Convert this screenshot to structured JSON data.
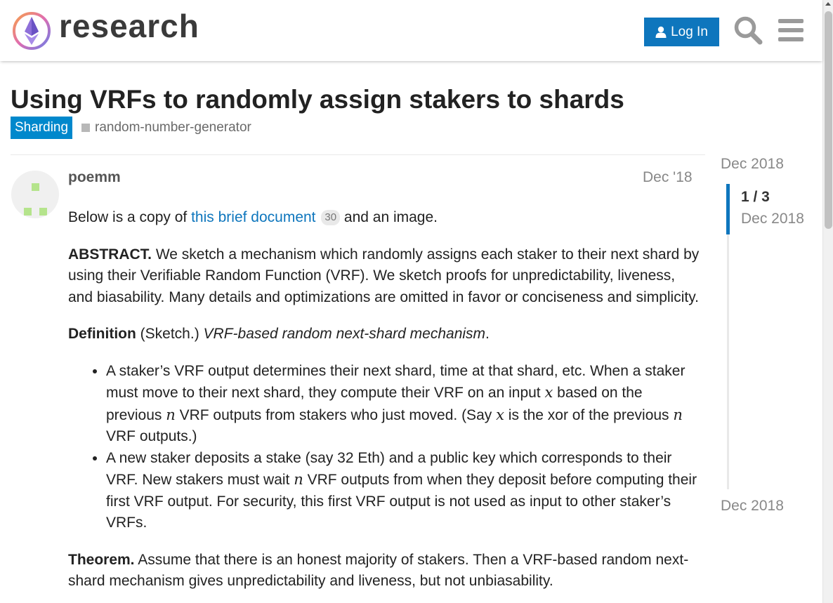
{
  "site": {
    "name": "research"
  },
  "header": {
    "login_label": "Log In"
  },
  "topic": {
    "title": "Using VRFs to randomly assign stakers to shards",
    "category": "Sharding",
    "tag": "random-number-generator"
  },
  "post": {
    "username": "poemm",
    "date": "Dec '18",
    "intro_pre": "Below is a copy of ",
    "intro_link": "this brief document",
    "intro_clicks": "30",
    "intro_post": " and an image.",
    "abstract_label": "ABSTRACT.",
    "abstract_text": " We sketch a mechanism which randomly assigns each staker to their next shard by using their Verifiable Random Function (VRF). We sketch proofs for unpredictability, liveness, and biasability. Many details and optimizations are omitted in favor or conciseness and simplicity.",
    "definition_label": "Definition",
    "definition_paren": " (Sketch.) ",
    "definition_name": "VRF-based random next-shard mechanism",
    "definition_end": ".",
    "bullet1_a": "A staker’s VRF output determines their next shard, time at that shard, etc. When a staker must move to their next shard, they compute their VRF on an input ",
    "bullet1_b": " based on the previous ",
    "bullet1_c": " VRF outputs from stakers who just moved. (Say ",
    "bullet1_d": " is the xor of the previous ",
    "bullet1_e": " VRF outputs.)",
    "bullet2_a": "A new staker deposits a stake (say 32 Eth) and a public key which corresponds to their VRF. New stakers must wait ",
    "bullet2_b": " VRF outputs from when they deposit before computing their first VRF output. For security, this first VRF output is not used as input to other staker’s VRFs.",
    "math_x": "x",
    "math_n": "n",
    "theorem_label": "Theorem.",
    "theorem_text": " Assume that there is an honest majority of stakers. Then a VRF-based random next-shard mechanism gives unpredictability and liveness, but not unbiasability."
  },
  "timeline": {
    "top_date": "Dec 2018",
    "position": "1 / 3",
    "current_date": "Dec 2018",
    "bottom_date": "Dec 2018"
  },
  "colors": {
    "accent": "#0e76bd",
    "category": "#0088cc",
    "avatar_fg": "#b5e48c"
  },
  "icons": [
    "logo-icon",
    "user-icon",
    "search-icon",
    "menu-icon"
  ]
}
